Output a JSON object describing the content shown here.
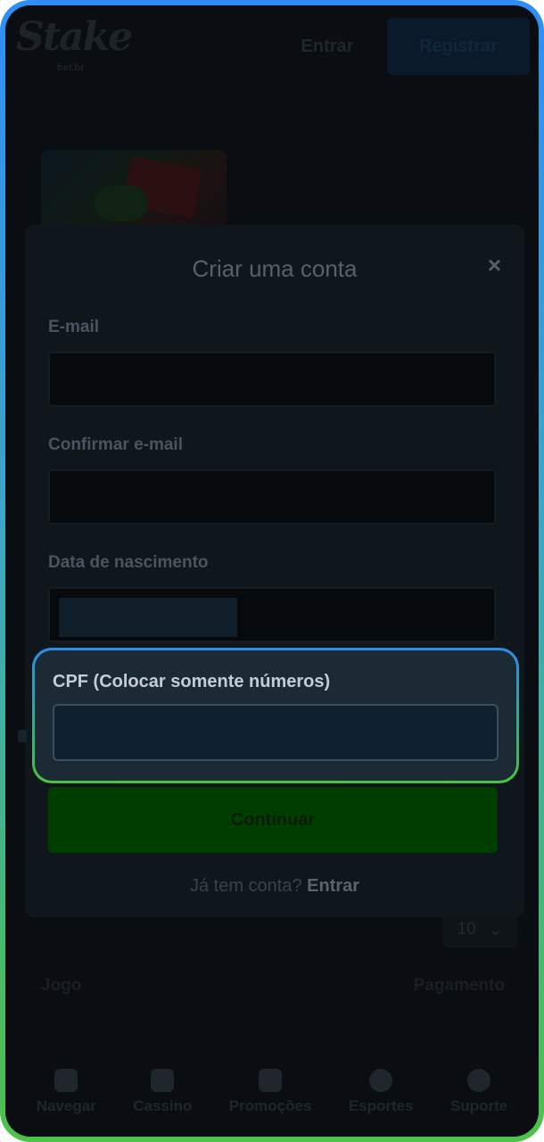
{
  "header": {
    "logo_text": "Stake",
    "logo_sub": "bet.br",
    "login_label": "Entrar",
    "register_label": "Registrar"
  },
  "modal": {
    "title": "Criar uma conta",
    "close_symbol": "×",
    "fields": {
      "email_label": "E-mail",
      "confirm_email_label": "Confirmar e-mail",
      "birthdate_label": "Data de nascimento",
      "cpf_label": "CPF (Colocar somente números)"
    },
    "continue_label": "Continuar",
    "have_account_text": "Já tem conta?",
    "login_link": "Entrar"
  },
  "background": {
    "per_page_value": "10",
    "table_header_left": "Jogo",
    "table_header_right": "Pagamento"
  },
  "bottom_nav": {
    "items": [
      {
        "label": "Navegar",
        "icon": "browse-icon"
      },
      {
        "label": "Cassino",
        "icon": "cards-icon"
      },
      {
        "label": "Promoções",
        "icon": "gift-icon"
      },
      {
        "label": "Esportes",
        "icon": "ball-icon"
      },
      {
        "label": "Suporte",
        "icon": "chat-icon"
      }
    ]
  },
  "colors": {
    "frame_top": "#2f8ef5",
    "frame_bottom": "#4ec24a",
    "continue_button": "#003e00"
  }
}
